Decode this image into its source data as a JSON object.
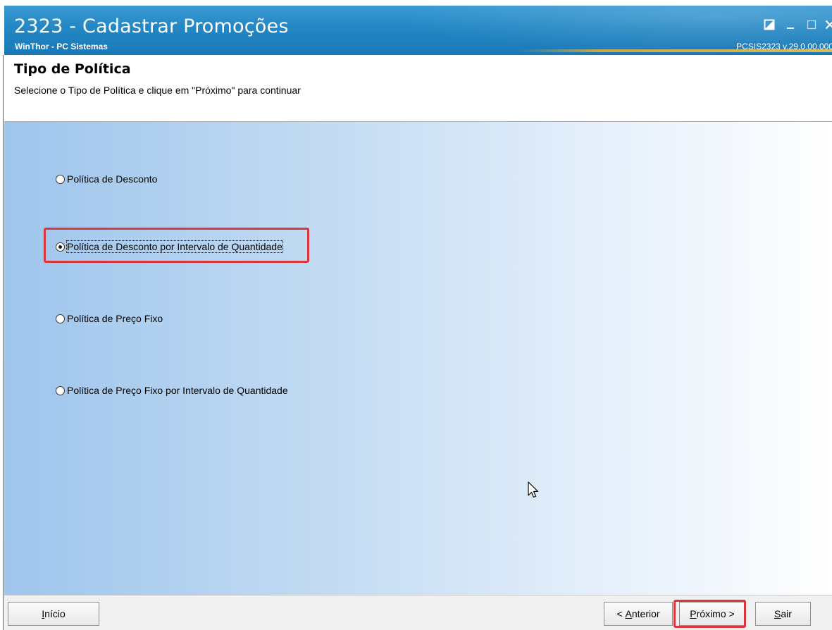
{
  "window": {
    "title": "2323 - Cadastrar Promoções",
    "subtitle": "WinThor - PC Sistemas",
    "version": "PCSIS2323  v.29.0.00.000"
  },
  "header": {
    "title": "Tipo de Política",
    "instruction": "Selecione o Tipo de Política e clique em \"Próximo\" para continuar"
  },
  "options": [
    {
      "label": "Política de Desconto",
      "checked": false
    },
    {
      "label": "Política de Desconto por Intervalo de Quantidade",
      "checked": true
    },
    {
      "label": "Política de Preço Fixo",
      "checked": false
    },
    {
      "label": "Política de Preço Fixo por Intervalo de Quantidade",
      "checked": false
    }
  ],
  "buttons": {
    "inicio": {
      "mnemonic": "I",
      "rest": "nício"
    },
    "anterior": {
      "prefix": "< ",
      "mnemonic": "A",
      "rest": "nterior"
    },
    "proximo": {
      "mnemonic": "P",
      "rest": "róximo >"
    },
    "sair": {
      "mnemonic": "S",
      "rest": "air"
    }
  },
  "colors": {
    "titlebar": "#2387c4",
    "highlight": "#d9363e",
    "content_gradient_start": "#9ec5ec"
  },
  "icons": {
    "restore": "restore-window-icon",
    "minimize": "minimize-icon",
    "maximize": "maximize-icon",
    "close": "close-icon",
    "cursor": "mouse-pointer-icon"
  }
}
